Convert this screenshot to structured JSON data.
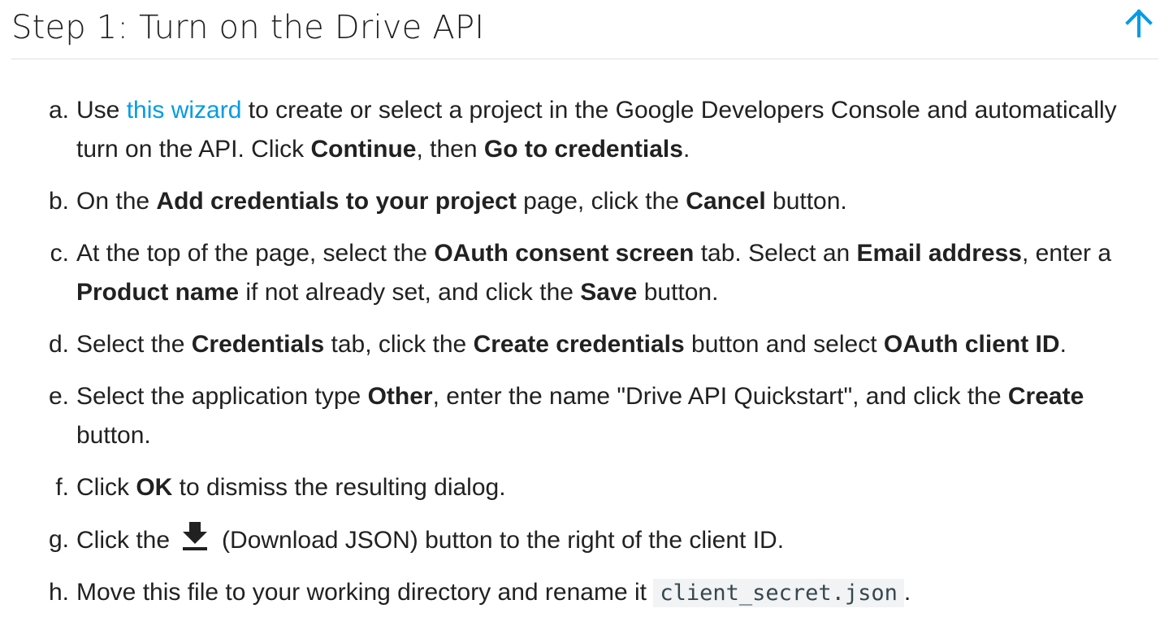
{
  "header": {
    "title": "Step 1: Turn on the Drive API",
    "back_to_top_icon": "arrow-up-icon",
    "accent_color": "#039be5"
  },
  "steps": [
    {
      "marker": "a.",
      "t1": "Use ",
      "link": "this wizard",
      "t2": " to create or select a project in the Google Developers Console and automatically turn on the API. Click ",
      "b1": "Continue",
      "t3": ", then ",
      "b2": "Go to credentials",
      "t4": "."
    },
    {
      "marker": "b.",
      "t1": "On the ",
      "b1": "Add credentials to your project",
      "t2": " page, click the ",
      "b2": "Cancel",
      "t3": " button."
    },
    {
      "marker": "c.",
      "t1": "At the top of the page, select the ",
      "b1": "OAuth consent screen",
      "t2": " tab. Select an ",
      "b2": "Email address",
      "t3": ", enter a ",
      "b3": "Product name",
      "t4": " if not already set, and click the ",
      "b4": "Save",
      "t5": " button."
    },
    {
      "marker": "d.",
      "t1": "Select the ",
      "b1": "Credentials",
      "t2": " tab, click the ",
      "b2": "Create credentials",
      "t3": " button and select ",
      "b3": "OAuth client ID",
      "t4": "."
    },
    {
      "marker": "e.",
      "t1": "Select the application type ",
      "b1": "Other",
      "t2": ", enter the name \"Drive API Quickstart\", and click the ",
      "b2": "Create",
      "t3": " button."
    },
    {
      "marker": "f.",
      "t1": "Click ",
      "b1": "OK",
      "t2": " to dismiss the resulting dialog."
    },
    {
      "marker": "g.",
      "t1": "Click the",
      "icon": "download-icon",
      "t2": "(Download JSON) button to the right of the client ID."
    },
    {
      "marker": "h.",
      "t1": "Move this file to your working directory and rename it ",
      "code": "client_secret.json",
      "t2": "."
    }
  ]
}
